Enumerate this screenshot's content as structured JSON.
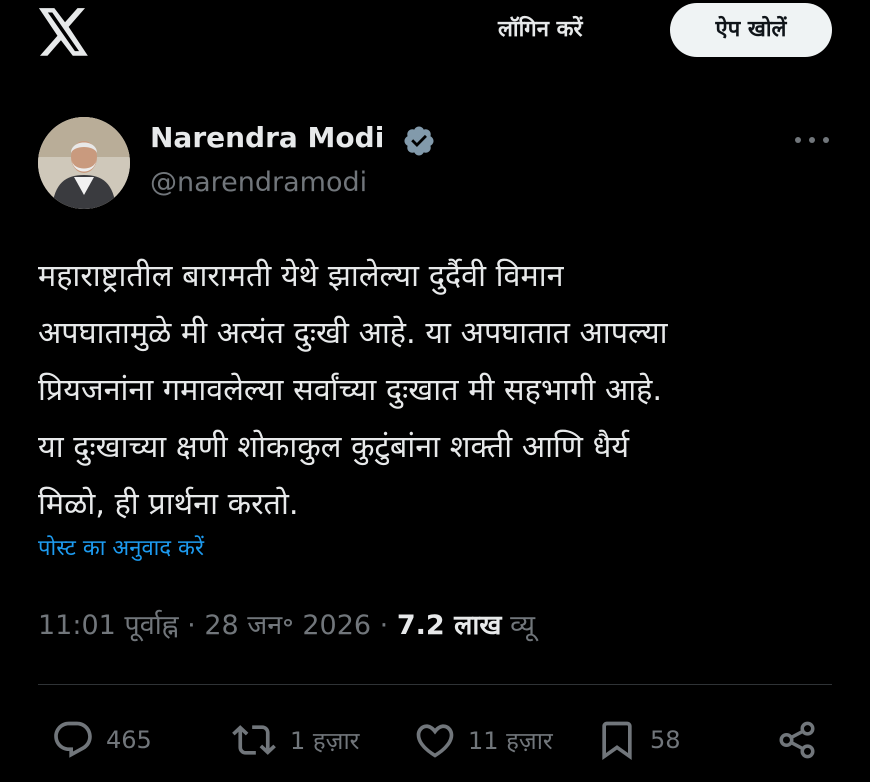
{
  "header": {
    "logo_icon": "x-logo-icon",
    "login_label": "लॉगिन करें",
    "open_app_label": "ऐप खोलें"
  },
  "author": {
    "name": "Narendra Modi",
    "handle": "@narendramodi",
    "verified": true,
    "avatar_icon": "profile-photo"
  },
  "tweet": {
    "lines": [
      "महाराष्ट्रातील बारामती येथे झालेल्या दुर्दैवी विमान",
      "अपघातामुळे मी अत्यंत दुःखी आहे. या अपघातात आपल्या",
      "प्रियजनांना गमावलेल्या सर्वांच्या दुःखात मी सहभागी आहे.",
      "या दुःखाच्या क्षणी शोकाकुल कुटुंबांना शक्ती आणि धैर्य",
      "मिळो, ही प्रार्थना करतो."
    ],
    "translate_label": "पोस्ट का अनुवाद करें"
  },
  "meta": {
    "time": "11:01 पूर्वाह्न",
    "date": "28 जन॰ 2026",
    "views_count": "7.2 लाख",
    "views_label": "व्यू",
    "separator": "·"
  },
  "actions": {
    "replies": "465",
    "reposts": "1 हज़ार",
    "likes": "11 हज़ार",
    "bookmarks": "58"
  },
  "colors": {
    "background": "#000000",
    "text": "#e7e9ea",
    "secondary": "#71767b",
    "link": "#1d9bf0",
    "verified": "#829aab"
  }
}
